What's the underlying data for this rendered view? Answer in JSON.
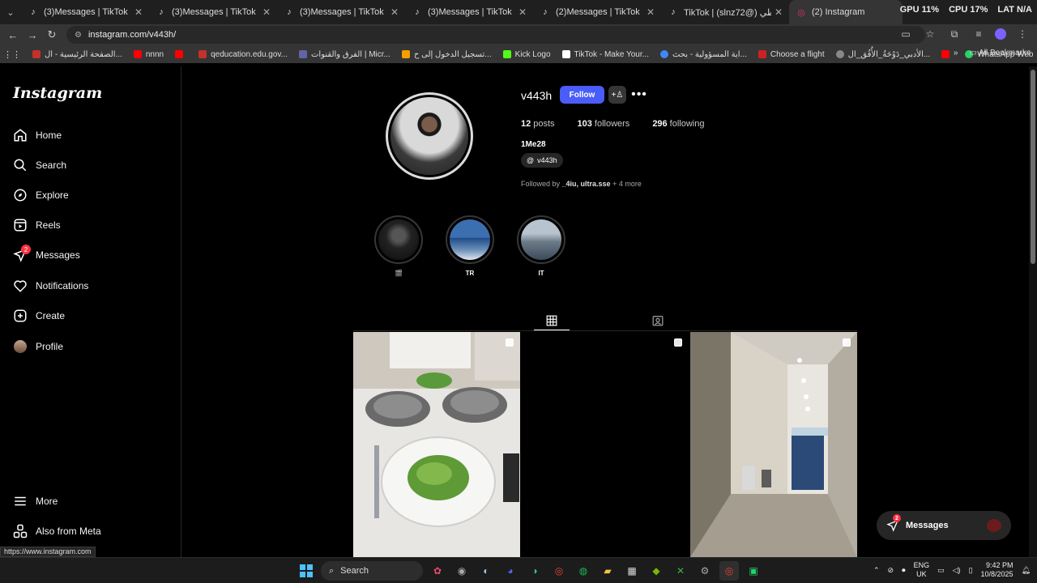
{
  "browser": {
    "tabs": [
      {
        "title": "(3)Messages | TikTok",
        "icon": "tiktok-icon",
        "active": false
      },
      {
        "title": "(3)Messages | TikTok",
        "icon": "tiktok-icon",
        "active": false
      },
      {
        "title": "(3)Messages | TikTok",
        "icon": "tiktok-icon",
        "active": false
      },
      {
        "title": "(3)Messages | TikTok",
        "icon": "tiktok-icon",
        "active": false
      },
      {
        "title": "(2)Messages | TikTok",
        "icon": "tiktok-icon",
        "active": false
      },
      {
        "title": "TikTok | (slnz72@) السلطي",
        "icon": "tiktok-icon",
        "active": false
      },
      {
        "title": "(2) Instagram",
        "icon": "instagram-icon",
        "active": true
      }
    ],
    "sysmon": {
      "gpu_label": "GPU",
      "gpu_value": "11%",
      "cpu_label": "CPU",
      "cpu_value": "17%",
      "lat_label": "LAT",
      "lat_value": "N/A"
    },
    "url": "instagram.com/v443h/",
    "bookmarks": [
      {
        "label": "الصفحة الرئيسية - ال...",
        "color": "#c4302b"
      },
      {
        "label": "nnnn",
        "color": "#ff0000"
      },
      {
        "label": "",
        "color": "#ff0000"
      },
      {
        "label": "qeducation.edu.gov...",
        "color": "#c4302b"
      },
      {
        "label": "الفرق والقنوات | Micr...",
        "color": "#6264a7"
      },
      {
        "label": "تسجيل الدخول إلى ح...",
        "color": "#f3a000"
      },
      {
        "label": "Kick Logo",
        "color": "#53fc18"
      },
      {
        "label": "TikTok - Make Your...",
        "color": "#ffffff"
      },
      {
        "label": "اية المسؤولية - بحث...",
        "color": "#4285f4"
      },
      {
        "label": "Choose a flight",
        "color": "#cc2222"
      },
      {
        "label": "الأدبي_دَوْحَةُ_الأُفُق_ال...",
        "color": "#888888"
      },
      {
        "label": "",
        "color": "#ff0000"
      },
      {
        "label": "WhatsApp Web",
        "color": "#25d366"
      },
      {
        "label": "",
        "color": "#ff0000"
      }
    ],
    "all_bookmarks": "All Bookmarks"
  },
  "sidebar": {
    "logo": "Instagram",
    "items": [
      {
        "label": "Home",
        "icon": "home-icon"
      },
      {
        "label": "Search",
        "icon": "search-icon"
      },
      {
        "label": "Explore",
        "icon": "compass-icon"
      },
      {
        "label": "Reels",
        "icon": "reels-icon"
      },
      {
        "label": "Messages",
        "icon": "messenger-icon",
        "badge": "2"
      },
      {
        "label": "Notifications",
        "icon": "heart-icon"
      },
      {
        "label": "Create",
        "icon": "plus-square-icon"
      },
      {
        "label": "Profile",
        "icon": "avatar-icon"
      }
    ],
    "bottom": [
      {
        "label": "More",
        "icon": "menu-icon"
      },
      {
        "label": "Also from Meta",
        "icon": "meta-icon"
      }
    ]
  },
  "profile": {
    "username": "v443h",
    "follow_label": "Follow",
    "posts_count": "12",
    "posts_label": "posts",
    "followers_count": "103",
    "followers_label": "followers",
    "following_count": "296",
    "following_label": "following",
    "full_name": "1Me28",
    "threads_handle": "v443h",
    "followed_by_prefix": "Followed by ",
    "followed_by_names": "_4iu, ultra.sse",
    "followed_by_more": " + 4 more"
  },
  "highlights": [
    {
      "label": "🎬"
    },
    {
      "label": "TR"
    },
    {
      "label": "IT"
    }
  ],
  "floating_messages": {
    "label": "Messages",
    "badge": "2"
  },
  "status_url": "https://www.instagram.com",
  "taskbar": {
    "search_label": "Search",
    "lang_top": "ENG",
    "lang_bottom": "UK",
    "time": "9:42 PM",
    "date": "10/8/2025"
  }
}
